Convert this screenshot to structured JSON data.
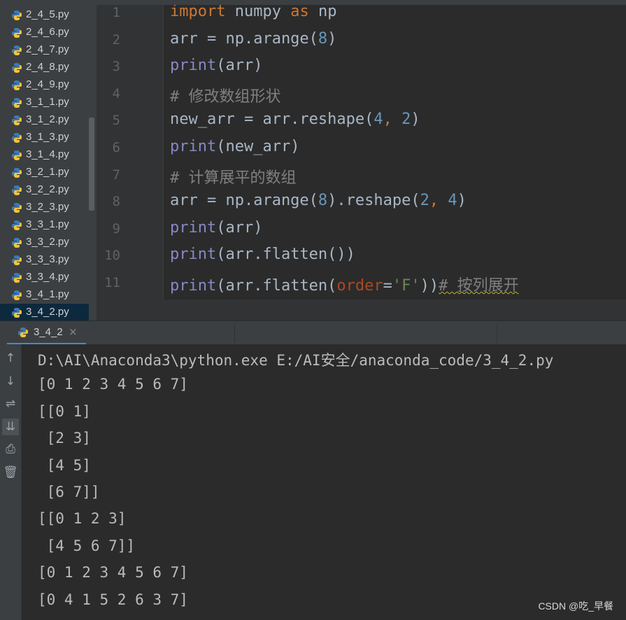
{
  "project_tree": {
    "files": [
      {
        "name": "2_4_5.py"
      },
      {
        "name": "2_4_6.py"
      },
      {
        "name": "2_4_7.py"
      },
      {
        "name": "2_4_8.py"
      },
      {
        "name": "2_4_9.py"
      },
      {
        "name": "3_1_1.py"
      },
      {
        "name": "3_1_2.py"
      },
      {
        "name": "3_1_3.py"
      },
      {
        "name": "3_1_4.py"
      },
      {
        "name": "3_2_1.py"
      },
      {
        "name": "3_2_2.py"
      },
      {
        "name": "3_2_3.py"
      },
      {
        "name": "3_3_1.py"
      },
      {
        "name": "3_3_2.py"
      },
      {
        "name": "3_3_3.py"
      },
      {
        "name": "3_3_4.py"
      },
      {
        "name": "3_4_1.py"
      },
      {
        "name": "3_4_2.py",
        "selected": true
      }
    ]
  },
  "editor": {
    "lines": [
      {
        "n": "1",
        "tokens": [
          [
            "kw",
            "import"
          ],
          [
            "t",
            " numpy "
          ],
          [
            "kw",
            "as"
          ],
          [
            "t",
            " np"
          ]
        ]
      },
      {
        "n": "2",
        "tokens": [
          [
            "t",
            "arr = np.arange("
          ],
          [
            "num",
            "8"
          ],
          [
            "t",
            ")"
          ]
        ]
      },
      {
        "n": "3",
        "tokens": [
          [
            "bi",
            "print"
          ],
          [
            "t",
            "(arr)"
          ]
        ]
      },
      {
        "n": "4",
        "tokens": [
          [
            "cm",
            "# 修改数组形状"
          ]
        ]
      },
      {
        "n": "5",
        "tokens": [
          [
            "t",
            "new_arr = arr.reshape("
          ],
          [
            "num",
            "4"
          ],
          [
            "kw",
            ","
          ],
          [
            "t",
            " "
          ],
          [
            "num",
            "2"
          ],
          [
            "t",
            ")"
          ]
        ]
      },
      {
        "n": "6",
        "tokens": [
          [
            "bi",
            "print"
          ],
          [
            "t",
            "(new_arr)"
          ]
        ]
      },
      {
        "n": "7",
        "tokens": [
          [
            "cm",
            "# 计算展平的数组"
          ]
        ]
      },
      {
        "n": "8",
        "tokens": [
          [
            "t",
            "arr = np.arange("
          ],
          [
            "num",
            "8"
          ],
          [
            "t",
            ").reshape("
          ],
          [
            "num",
            "2"
          ],
          [
            "kw",
            ","
          ],
          [
            "t",
            " "
          ],
          [
            "num",
            "4"
          ],
          [
            "t",
            ")"
          ]
        ]
      },
      {
        "n": "9",
        "tokens": [
          [
            "bi",
            "print"
          ],
          [
            "t",
            "(arr)"
          ]
        ]
      },
      {
        "n": "10",
        "tokens": [
          [
            "bi",
            "print"
          ],
          [
            "t",
            "(arr.flatten())"
          ]
        ]
      },
      {
        "n": "11",
        "tokens": [
          [
            "bi",
            "print"
          ],
          [
            "t",
            "(arr.flatten("
          ],
          [
            "kwarg",
            "order"
          ],
          [
            "t",
            "="
          ],
          [
            "str",
            "'F'"
          ],
          [
            "t",
            "))"
          ],
          [
            "cmsq",
            "# 按列展开"
          ]
        ]
      }
    ]
  },
  "run_panel": {
    "tab_label": "3_4_2",
    "close_glyph": "×",
    "tools": [
      {
        "name": "rerun-up-icon",
        "glyph": "↑"
      },
      {
        "name": "down-arrow-icon",
        "glyph": "↓"
      },
      {
        "name": "soft-wrap-icon",
        "glyph": "⇌"
      },
      {
        "name": "scroll-to-end-icon",
        "glyph": "⇊",
        "active": true
      },
      {
        "name": "print-icon",
        "glyph": "⎙"
      },
      {
        "name": "trash-icon",
        "glyph": "🗑"
      }
    ],
    "console_lines": [
      "D:\\AI\\Anaconda3\\python.exe E:/AI安全/anaconda_code/3_4_2.py",
      "[0 1 2 3 4 5 6 7]",
      "[[0 1]",
      " [2 3]",
      " [4 5]",
      " [6 7]]",
      "[[0 1 2 3]",
      " [4 5 6 7]]",
      "[0 1 2 3 4 5 6 7]",
      "[0 4 1 5 2 6 3 7]"
    ]
  },
  "watermark": "CSDN @吃_早餐"
}
